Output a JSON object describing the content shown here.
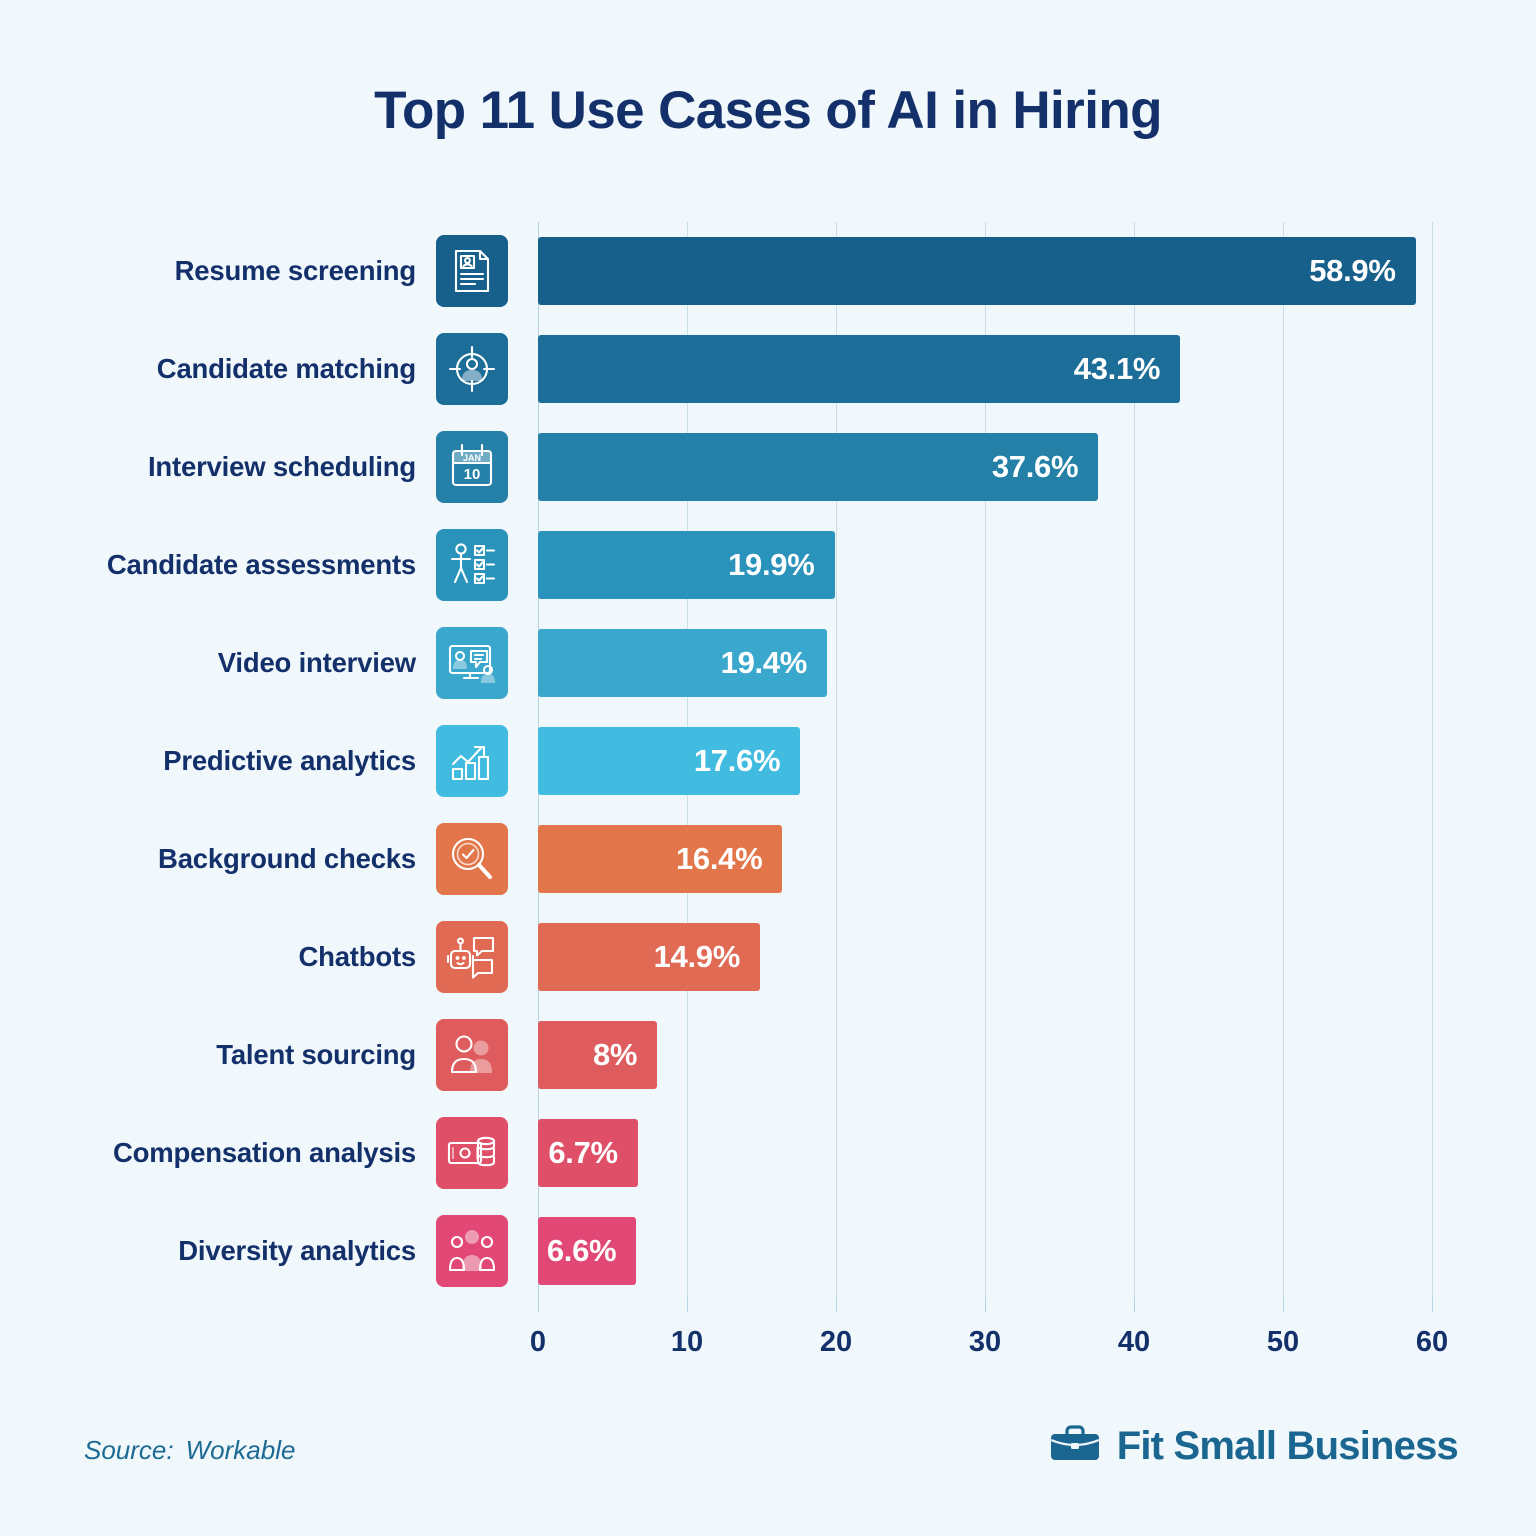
{
  "title": "Top 11 Use Cases of AI in Hiring",
  "footer": {
    "source_label": "Source:",
    "source_value": "Workable",
    "logo_text": "Fit Small Business",
    "logo_icon": "briefcase-icon"
  },
  "chart_data": {
    "type": "bar",
    "orientation": "horizontal",
    "title": "Top 11 Use Cases of AI in Hiring",
    "xlabel": "",
    "ylabel": "",
    "xlim": [
      0,
      60
    ],
    "xticks": [
      "0",
      "10",
      "20",
      "30",
      "40",
      "50",
      "60"
    ],
    "grid": "vertical",
    "legend": "none",
    "categories": [
      "Resume screening",
      "Candidate matching",
      "Interview scheduling",
      "Candidate assessments",
      "Video interview",
      "Predictive analytics",
      "Background checks",
      "Chatbots",
      "Talent sourcing",
      "Compensation analysis",
      "Diversity analytics"
    ],
    "values": [
      58.9,
      43.1,
      37.6,
      19.9,
      19.4,
      17.6,
      16.4,
      14.9,
      8,
      6.7,
      6.6
    ],
    "value_labels": [
      "58.9%",
      "43.1%",
      "37.6%",
      "19.9%",
      "19.4%",
      "17.6%",
      "16.4%",
      "14.9%",
      "8%",
      "6.7%",
      "6.6%"
    ],
    "colors": [
      "#18608c",
      "#1c6e98",
      "#2580a8",
      "#2a93bb",
      "#3aa7cc",
      "#41bbdf",
      "#e2764a",
      "#e06a54",
      "#de5c5e",
      "#e04f68",
      "#e14876"
    ],
    "icons": [
      "resume-document-icon",
      "target-person-icon",
      "calendar-icon",
      "assessment-checklist-icon",
      "video-interview-icon",
      "growth-chart-icon",
      "magnifier-check-icon",
      "chatbot-icon",
      "people-pair-icon",
      "money-coins-icon",
      "diverse-group-icon"
    ],
    "calendar_icon_text": {
      "month": "JAN",
      "day": "10"
    }
  },
  "colors": {
    "background": "#f1f8fc",
    "title": "#14306b",
    "label": "#14306b",
    "gridline": "#c9dde8",
    "value_text": "#ffffff",
    "source_text": "#1d6a94",
    "logo": "#1a6690"
  }
}
